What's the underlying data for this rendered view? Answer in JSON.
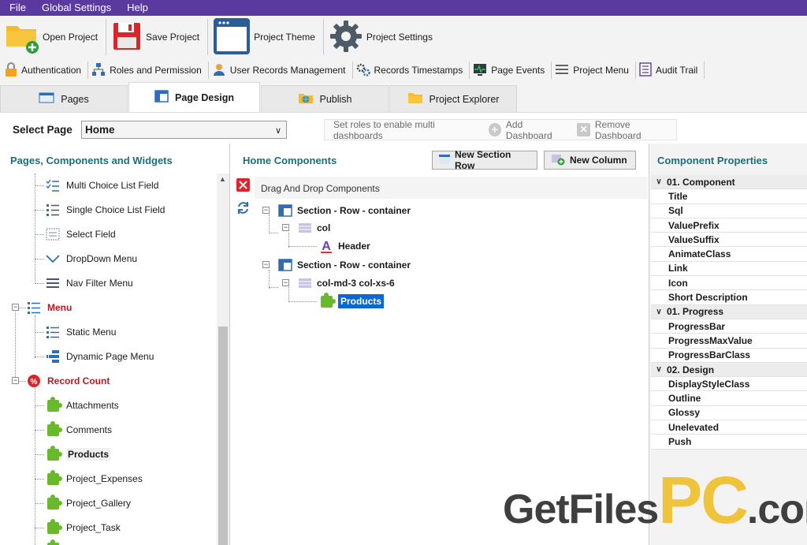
{
  "menubar": {
    "items": [
      "File",
      "Global Settings",
      "Help"
    ]
  },
  "toolbar": {
    "open_project": "Open Project",
    "save_project": "Save Project",
    "project_theme": "Project Theme",
    "project_settings": "Project Settings"
  },
  "toolbar2": {
    "authentication": "Authentication",
    "roles": "Roles and Permission",
    "user_records": "User Records Management",
    "timestamps": "Records Timestamps",
    "page_events": "Page Events",
    "project_menu": "Project Menu",
    "audit_trail": "Audit Trail"
  },
  "tabs": {
    "pages": "Pages",
    "page_design": "Page Design",
    "publish": "Publish",
    "project_explorer": "Project Explorer"
  },
  "select_bar": {
    "label": "Select Page",
    "value": "Home",
    "hint": "Set roles to enable multi dashboards",
    "add_dashboard": "Add Dashboard",
    "remove_dashboard": "Remove Dashboard"
  },
  "left_panel": {
    "title": "Pages, Components and Widgets",
    "items": [
      "Multi Choice List Field",
      "Single Choice List Field",
      "Select Field",
      "DropDown Menu",
      "Nav Filter Menu",
      "Menu",
      "Static Menu",
      "Dynamic Page Menu",
      "Record Count",
      "Attachments",
      "Comments",
      "Products",
      "Project_Expenses",
      "Project_Gallery",
      "Project_Task"
    ]
  },
  "middle_panel": {
    "title": "Home Components",
    "new_section_row": "New Section Row",
    "new_column": "New Column",
    "drop_hint": "Drag And Drop Components",
    "tree": [
      "Section - Row - container",
      "col",
      "Header",
      "Section - Row - container",
      "col-md-3 col-xs-6",
      "Products"
    ]
  },
  "right_panel": {
    "title": "Component Properties",
    "rows": [
      "01. Component",
      "Title",
      "Sql",
      "ValuePrefix",
      "ValueSuffix",
      "AnimateClass",
      "Link",
      "Icon",
      "Short Description",
      "01. Progress",
      "ProgressBar",
      "ProgressMaxValue",
      "ProgressBarClass",
      "02. Design",
      "DisplayStyleClass",
      "Outline",
      "Glossy",
      "Unelevated",
      "Push"
    ]
  },
  "watermark": {
    "part1": "GetFiles",
    "part2": "PC",
    "part3": ".com"
  }
}
